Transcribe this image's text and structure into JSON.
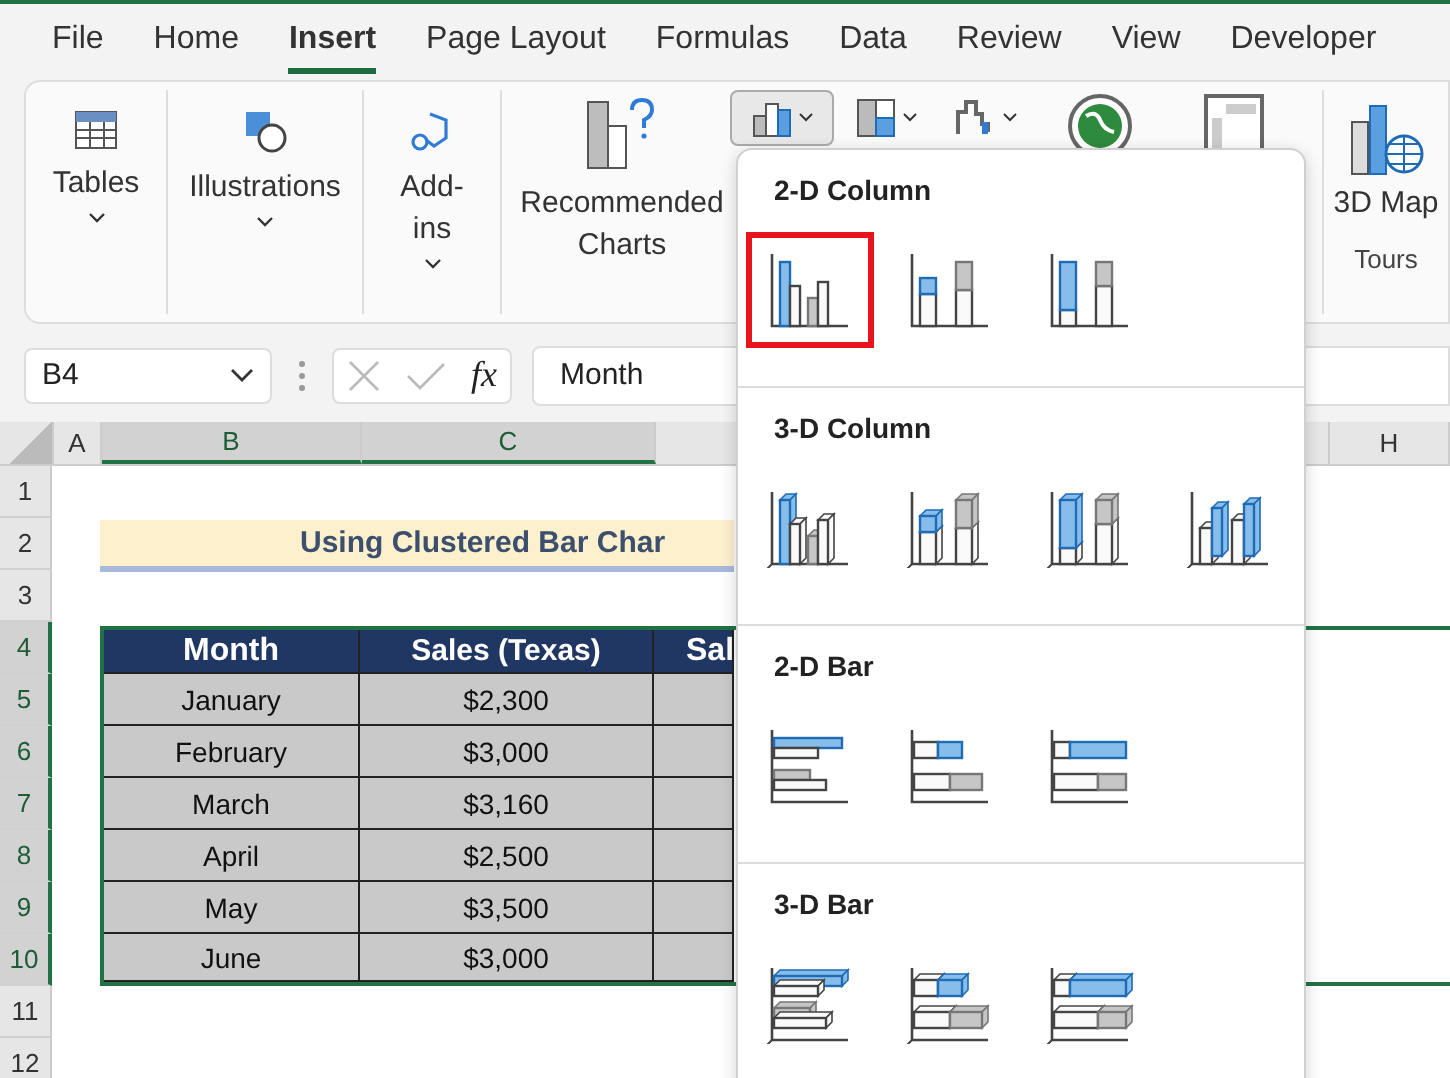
{
  "menu_tabs": [
    {
      "label": "File",
      "selected": false
    },
    {
      "label": "Home",
      "selected": false
    },
    {
      "label": "Insert",
      "selected": true
    },
    {
      "label": "Page Layout",
      "selected": false
    },
    {
      "label": "Formulas",
      "selected": false
    },
    {
      "label": "Data",
      "selected": false
    },
    {
      "label": "Review",
      "selected": false
    },
    {
      "label": "View",
      "selected": false
    },
    {
      "label": "Developer",
      "selected": false
    }
  ],
  "ribbon": {
    "groups": [
      {
        "kind": "tables",
        "label": "Tables"
      },
      {
        "kind": "illustrations",
        "label": "Illustrations"
      },
      {
        "kind": "addins",
        "label": "Add-ins"
      },
      {
        "kind": "recommended",
        "label": "Recommended Charts"
      }
    ],
    "map3d": {
      "label": "3D Map",
      "group": "Tours"
    }
  },
  "formula_bar": {
    "name_box": "B4",
    "fx": "fx",
    "value": "Month"
  },
  "columns": [
    {
      "label": "A",
      "selected": false
    },
    {
      "label": "B",
      "selected": true
    },
    {
      "label": "C",
      "selected": true
    },
    {
      "label": "H",
      "selected": false
    }
  ],
  "rows": [
    {
      "label": "1",
      "selected": false
    },
    {
      "label": "2",
      "selected": false
    },
    {
      "label": "3",
      "selected": false
    },
    {
      "label": "4",
      "selected": true
    },
    {
      "label": "5",
      "selected": true
    },
    {
      "label": "6",
      "selected": true
    },
    {
      "label": "7",
      "selected": true
    },
    {
      "label": "8",
      "selected": true
    },
    {
      "label": "9",
      "selected": true
    },
    {
      "label": "10",
      "selected": true
    },
    {
      "label": "11",
      "selected": false
    },
    {
      "label": "12",
      "selected": false
    }
  ],
  "sheet": {
    "title": "Using Clustered Bar Char",
    "table": {
      "columns": [
        "Month",
        "Sales (Texas)",
        "Sal"
      ],
      "rows": [
        [
          "January",
          "$2,300"
        ],
        [
          "February",
          "$3,000"
        ],
        [
          "March",
          "$3,160"
        ],
        [
          "April",
          "$2,500"
        ],
        [
          "May",
          "$3,500"
        ],
        [
          "June",
          "$3,000"
        ]
      ]
    }
  },
  "chart_menu": {
    "sections": [
      {
        "title": "2-D Column",
        "kind": "column",
        "options": [
          {
            "selected": true
          },
          {
            "selected": false
          },
          {
            "selected": false
          }
        ]
      },
      {
        "title": "3-D Column",
        "kind": "column3d",
        "options": [
          {
            "selected": false
          },
          {
            "selected": false
          },
          {
            "selected": false
          },
          {
            "selected": false
          }
        ]
      },
      {
        "title": "2-D Bar",
        "kind": "bar",
        "options": [
          {
            "selected": false
          },
          {
            "selected": false
          },
          {
            "selected": false
          }
        ]
      },
      {
        "title": "3-D Bar",
        "kind": "bar3d",
        "options": [
          {
            "selected": false
          },
          {
            "selected": false
          },
          {
            "selected": false
          }
        ]
      }
    ]
  }
}
